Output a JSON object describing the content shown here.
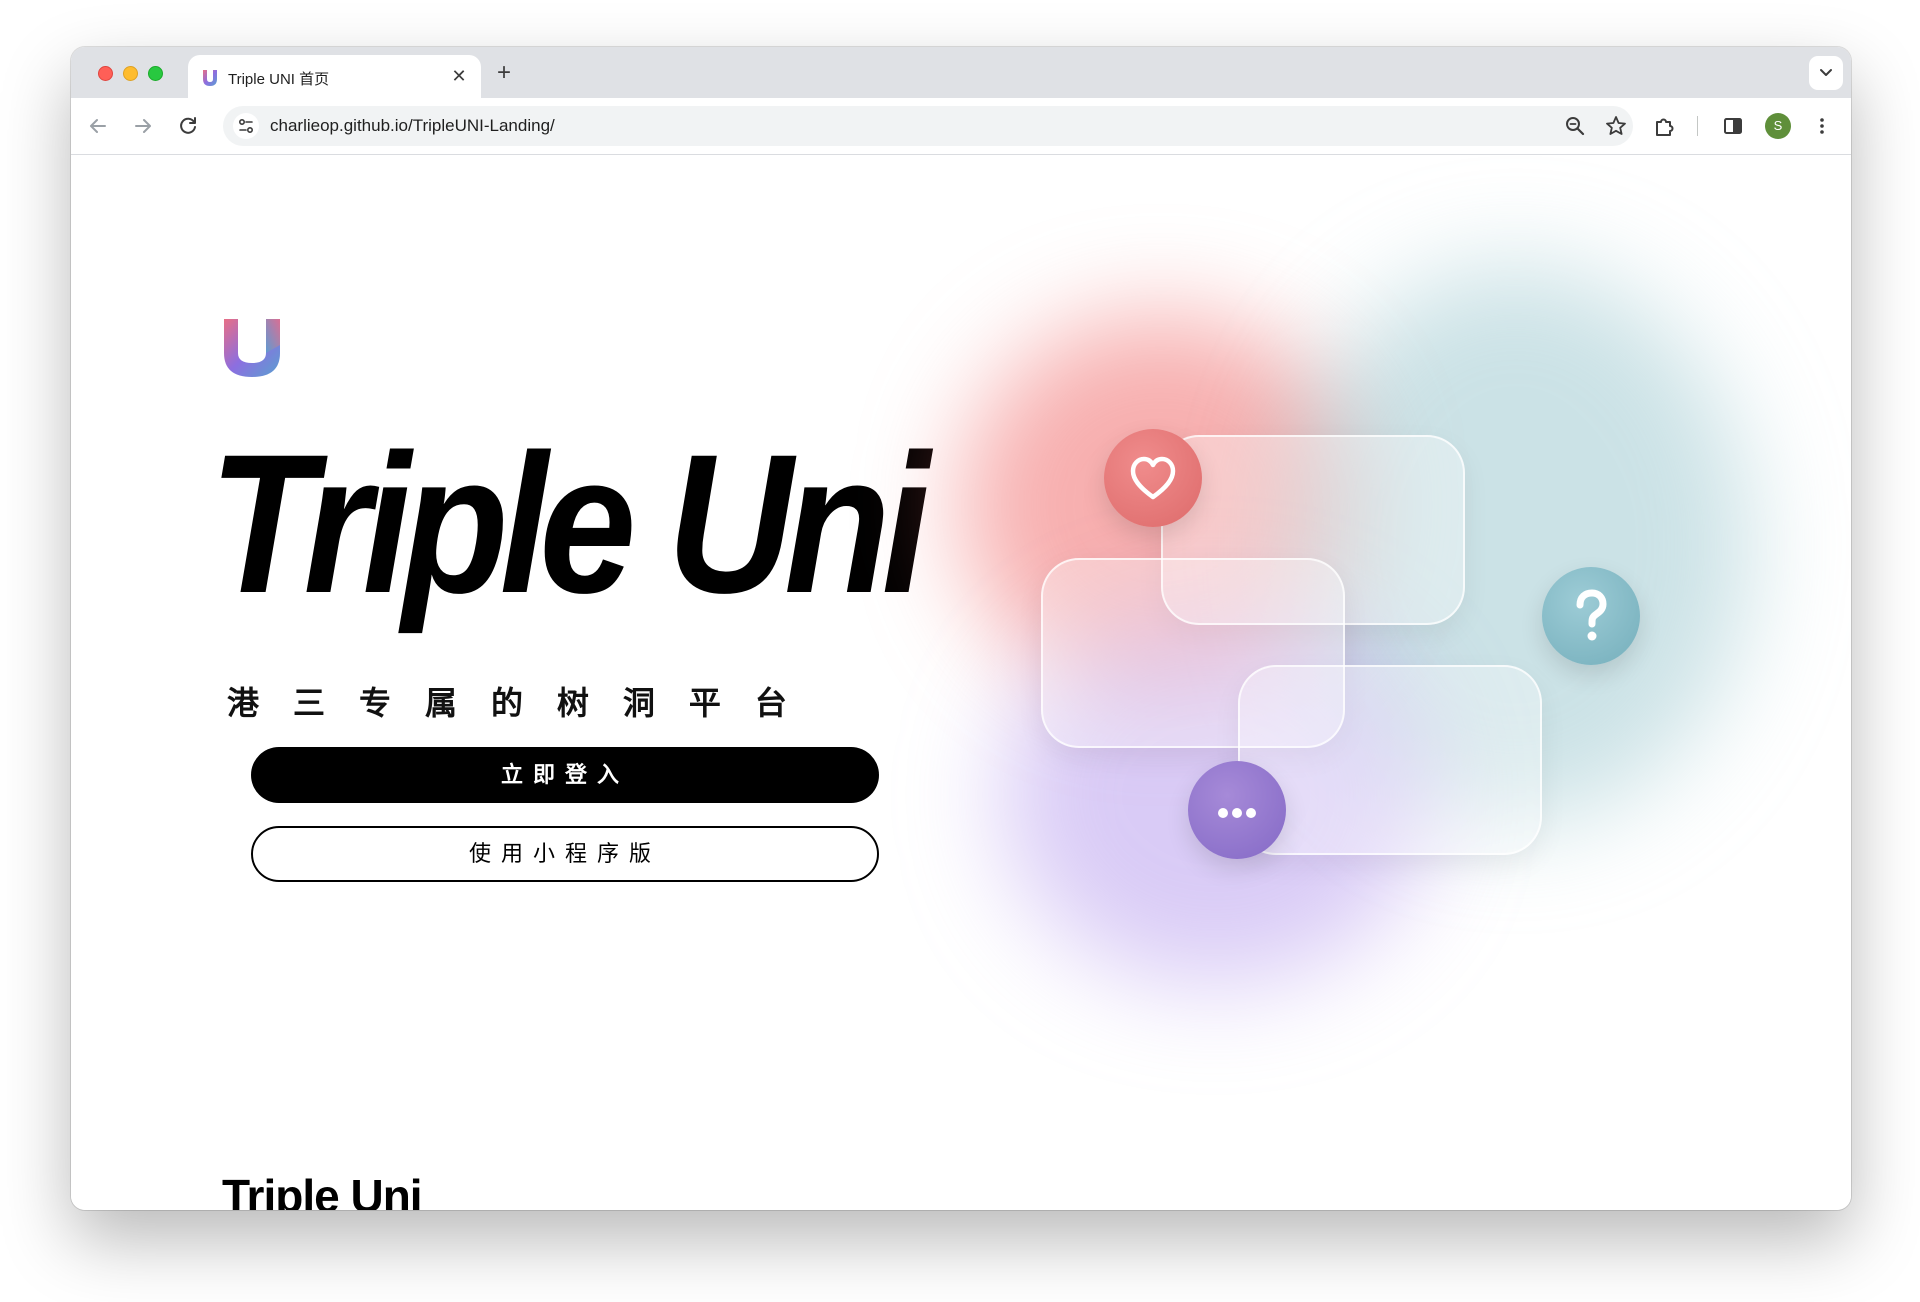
{
  "browser": {
    "tab": {
      "title": "Triple UNI 首页",
      "close_glyph": "✕"
    },
    "new_tab_glyph": "+",
    "address_bar": {
      "url": "charlieop.github.io/TripleUNI-Landing/"
    },
    "profile_initial": "S",
    "icons": {
      "back": "arrow-left-icon",
      "forward": "arrow-right-icon",
      "reload": "reload-icon",
      "site_info": "tune-icon",
      "zoom": "zoom-icon",
      "bookmark": "star-icon",
      "extensions": "puzzle-icon",
      "side_panel": "side-panel-icon",
      "menu": "kebab-menu-icon",
      "tab_search": "chevron-down-icon"
    }
  },
  "page": {
    "hero_title": "Triple Uni",
    "tagline_chars": [
      "港",
      "三",
      "专",
      "属",
      "的",
      "树",
      "洞",
      "平",
      "台"
    ],
    "login_button": "立即登入",
    "miniprogram_button": "使用小程序版",
    "section_title": "Triple Uni",
    "illustration": {
      "bubbles": [
        "heart-icon",
        "question-mark-icon",
        "ellipsis-icon"
      ],
      "colors": {
        "red": "#e57474",
        "teal": "#85bcc8",
        "purple": "#9678d0"
      }
    }
  },
  "colors": {
    "tab_strip": "#dfe1e5",
    "primary_button": "#000000",
    "logo_gradient": [
      "#e86f86",
      "#8c6ee0",
      "#5aa0d0"
    ]
  }
}
